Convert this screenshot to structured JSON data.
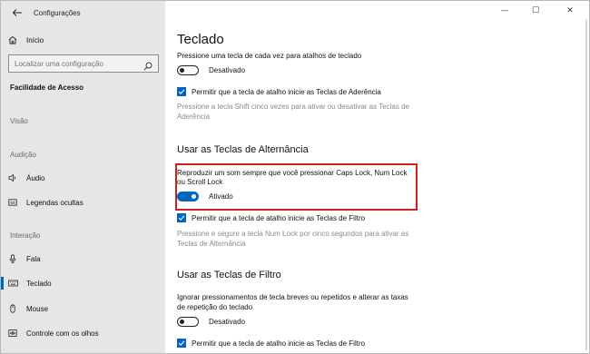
{
  "window": {
    "title": "Configurações",
    "minimize": "—",
    "maximize": "☐",
    "close": "✕"
  },
  "sidebar": {
    "home_label": "Início",
    "search_placeholder": "Localizar uma configuração",
    "section_title": "Facilidade de Acesso",
    "groups": {
      "vision": "Visão",
      "hearing": "Audição",
      "interaction": "Interação"
    },
    "items": [
      {
        "label": "Áudio",
        "icon": "speaker-icon"
      },
      {
        "label": "Legendas ocultas",
        "icon": "captions-icon"
      },
      {
        "label": "Fala",
        "icon": "microphone-icon"
      },
      {
        "label": "Teclado",
        "icon": "keyboard-icon",
        "active": true
      },
      {
        "label": "Mouse",
        "icon": "mouse-icon"
      },
      {
        "label": "Controle com os olhos",
        "icon": "eye-control-icon"
      }
    ]
  },
  "main": {
    "title": "Teclado",
    "sticky": {
      "desc": "Pressione uma tecla de cada vez para atalhos de teclado",
      "toggle_label": "Desativado",
      "toggle_on": false,
      "check_label": "Permitir que a tecla de atalho inicie as Teclas de Aderência",
      "check_checked": true,
      "hint_line1": "Pressione a tecla Shift cinco vezes para ativar ou desativar as Teclas de",
      "hint_line2": "Aderência"
    },
    "toggle_keys": {
      "heading": "Usar as Teclas de Alternância",
      "desc_line1": "Reproduzir um som sempre que você pressionar Caps Lock, Num Lock",
      "desc_line2": "ou Scroll Lock",
      "toggle_label": "Ativado",
      "toggle_on": true,
      "check_label": "Permitir que a tecla de atalho inicie as Teclas de Filtro",
      "check_checked": true,
      "hint_line1": "Pressione e segure a tecla Num Lock por cinco segundos para ativar as",
      "hint_line2": "Teclas de Alternância"
    },
    "filter_keys": {
      "heading": "Usar as Teclas de Filtro",
      "desc_line1": "Ignorar pressionamentos de tecla breves ou repetidos e alterar as taxas",
      "desc_line2": "de repetição do teclado",
      "toggle_label": "Desativado",
      "toggle_on": false,
      "check_label": "Permitir que a tecla de atalho inicie as Teclas de Filtro",
      "check_checked": true
    }
  },
  "colors": {
    "accent": "#0067c0",
    "highlight": "#d01f1f",
    "sidebar_bg": "#e6e6e6"
  }
}
